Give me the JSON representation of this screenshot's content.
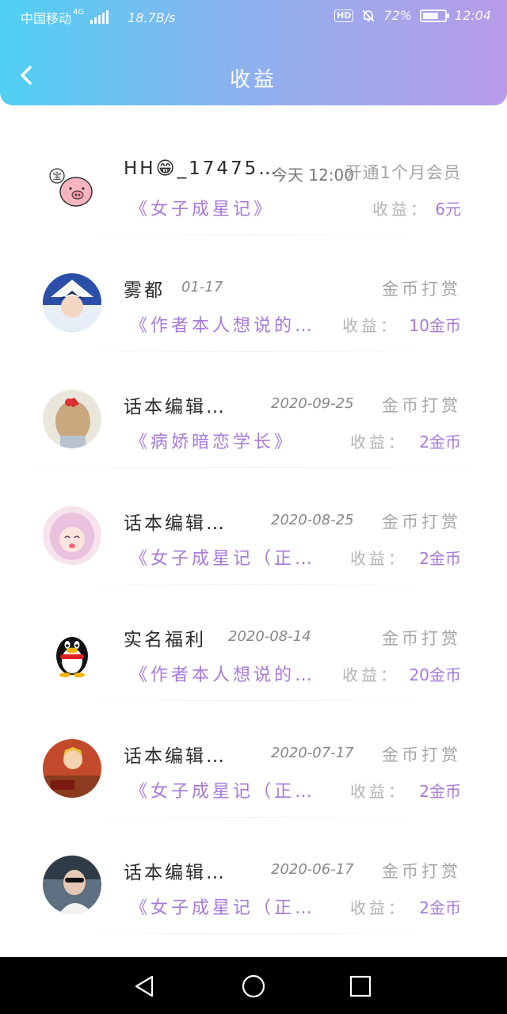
{
  "status_bar": {
    "carrier": "中国移动",
    "network": "4G",
    "speed": "18.7B/s",
    "hd": "HD",
    "battery": "72%",
    "battery_level": 0.72,
    "time": "12:04"
  },
  "header": {
    "title": "收益"
  },
  "colors": {
    "accent": "#a77ad8",
    "header_start": "#4fd0f3",
    "header_end": "#b79be8"
  },
  "items": [
    {
      "name": "HH😁_17475…",
      "date": "今天 12:00",
      "type": "开通1个月会员",
      "work": "《女子成星记》",
      "income_label": "收益：",
      "income": "6元"
    },
    {
      "name": "雾都",
      "date": "01-17",
      "type": "金币打赏",
      "work": "《作者本人想说的…",
      "income_label": "收益：",
      "income": "10金币"
    },
    {
      "name": "话本编辑…",
      "date": "2020-09-25",
      "type": "金币打赏",
      "work": "《病娇暗恋学长》",
      "income_label": "收益：",
      "income": "2金币"
    },
    {
      "name": "话本编辑…",
      "date": "2020-08-25",
      "type": "金币打赏",
      "work": "《女子成星记（正…",
      "income_label": "收益：",
      "income": "2金币"
    },
    {
      "name": "实名福利",
      "date": "2020-08-14",
      "type": "金币打赏",
      "work": "《作者本人想说的…",
      "income_label": "收益：",
      "income": "20金币"
    },
    {
      "name": "话本编辑…",
      "date": "2020-07-17",
      "type": "金币打赏",
      "work": "《女子成星记（正…",
      "income_label": "收益：",
      "income": "2金币"
    },
    {
      "name": "话本编辑…",
      "date": "2020-06-17",
      "type": "金币打赏",
      "work": "《女子成星记（正…",
      "income_label": "收益：",
      "income": "2金币"
    }
  ],
  "nav": {
    "back": "back-triangle-icon",
    "home": "home-circle-icon",
    "recents": "recents-square-icon"
  }
}
